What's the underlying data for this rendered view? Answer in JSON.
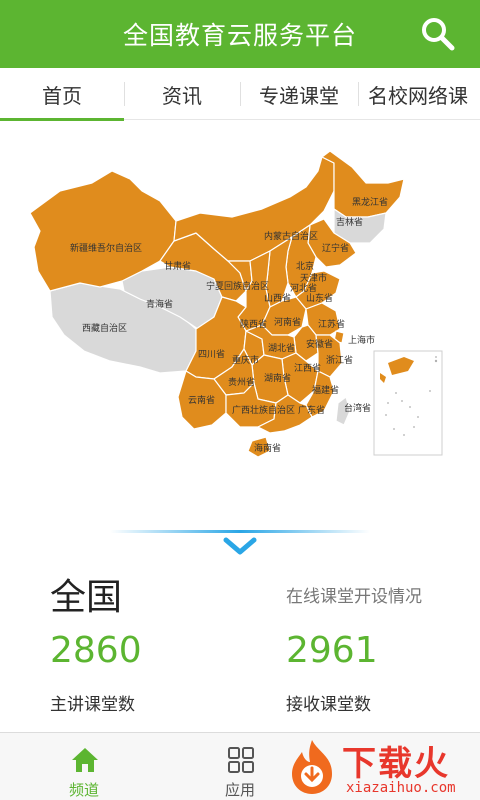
{
  "header": {
    "title": "全国教育云服务平台",
    "accent_color": "#5cb531",
    "search_icon": "search-icon"
  },
  "tabs": [
    {
      "label": "首页",
      "active": true
    },
    {
      "label": "资讯",
      "active": false
    },
    {
      "label": "专递课堂",
      "active": false
    },
    {
      "label": "名校网络课",
      "active": false
    }
  ],
  "map": {
    "active_color": "#e08c1d",
    "inactive_color": "#d9d9d9",
    "provinces": [
      {
        "name": "黑龙江省",
        "active": true
      },
      {
        "name": "吉林省",
        "active": false
      },
      {
        "name": "辽宁省",
        "active": true
      },
      {
        "name": "内蒙古自治区",
        "active": true
      },
      {
        "name": "新疆维吾尔自治区",
        "active": true
      },
      {
        "name": "甘肃省",
        "active": true
      },
      {
        "name": "北京",
        "active": true
      },
      {
        "name": "天津市",
        "active": true
      },
      {
        "name": "河北省",
        "active": true
      },
      {
        "name": "宁夏回族自治区",
        "active": true
      },
      {
        "name": "山西省",
        "active": true
      },
      {
        "name": "山东省",
        "active": true
      },
      {
        "name": "青海省",
        "active": false
      },
      {
        "name": "陕西省",
        "active": true
      },
      {
        "name": "河南省",
        "active": true
      },
      {
        "name": "江苏省",
        "active": true
      },
      {
        "name": "西藏自治区",
        "active": false
      },
      {
        "name": "安徽省",
        "active": true
      },
      {
        "name": "上海市",
        "active": true
      },
      {
        "name": "四川省",
        "active": true
      },
      {
        "name": "湖北省",
        "active": true
      },
      {
        "name": "重庆市",
        "active": true
      },
      {
        "name": "浙江省",
        "active": true
      },
      {
        "name": "江西省",
        "active": true
      },
      {
        "name": "湖南省",
        "active": true
      },
      {
        "name": "贵州省",
        "active": true
      },
      {
        "name": "福建省",
        "active": true
      },
      {
        "name": "云南省",
        "active": true
      },
      {
        "name": "广西壮族自治区",
        "active": true
      },
      {
        "name": "广东省",
        "active": true
      },
      {
        "name": "台湾省",
        "active": false
      },
      {
        "name": "海南省",
        "active": true
      }
    ]
  },
  "stats": {
    "region": "全国",
    "description": "在线课堂开设情况",
    "main_count": "2860",
    "main_label": "主讲课堂数",
    "receive_count": "2961",
    "receive_label": "接收课堂数"
  },
  "bottom_nav": [
    {
      "label": "频道",
      "icon": "home-icon",
      "active": true
    },
    {
      "label": "应用",
      "icon": "grid-icon",
      "active": false
    }
  ],
  "watermark": {
    "text": "下载火",
    "url": "xiazaihuo.com"
  }
}
